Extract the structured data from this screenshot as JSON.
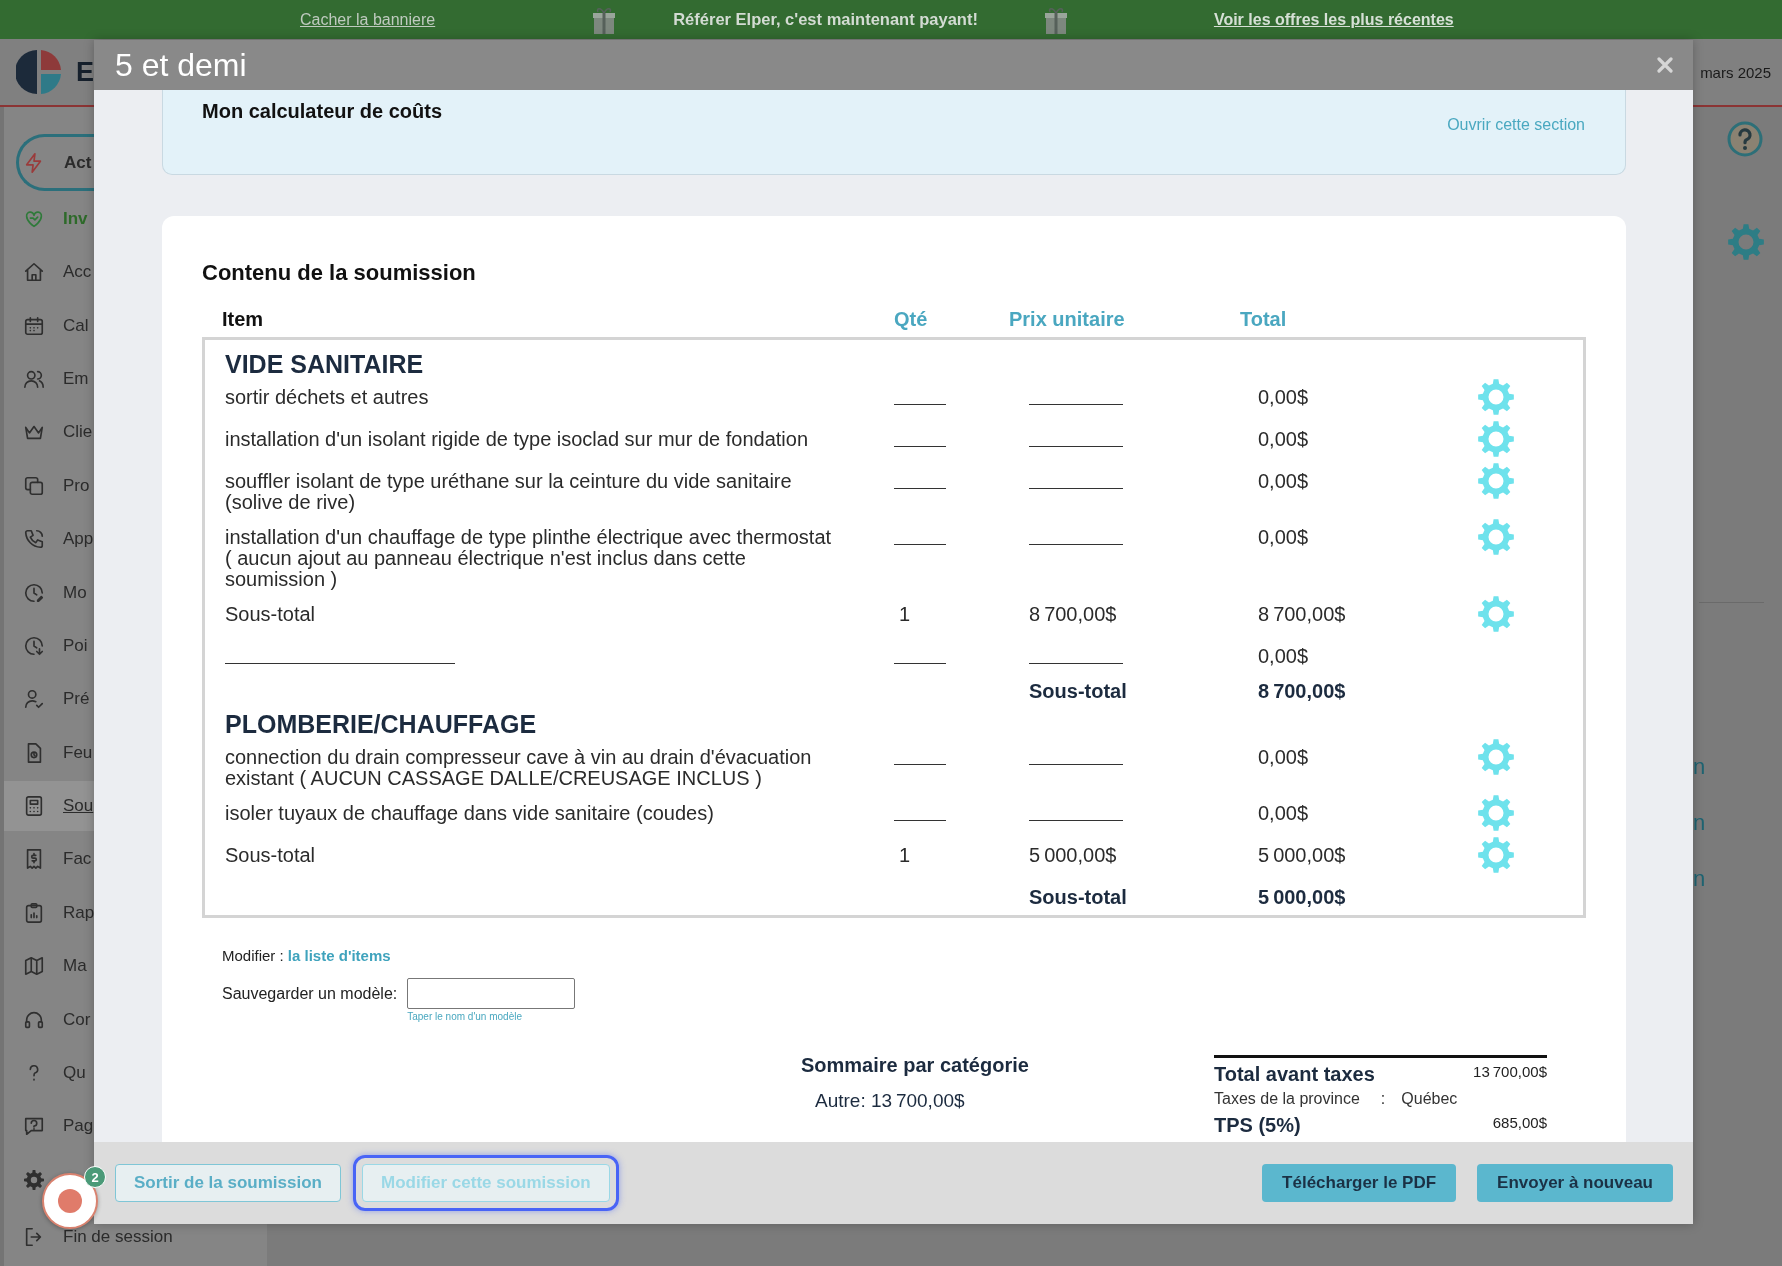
{
  "banner": {
    "hide_link": "Cacher la banniere",
    "message": "Référer Elper, c'est maintenant payant!",
    "offers_link": "Voir les offres les plus récentes"
  },
  "app_header": {
    "logo_text": "E",
    "date": "mars 2025"
  },
  "sidebar": {
    "items": [
      {
        "label": "Act",
        "kind": "action",
        "selected": false
      },
      {
        "label": "Inv",
        "kind": "invite",
        "selected": false
      },
      {
        "label": "Acc",
        "kind": "link",
        "selected": false
      },
      {
        "label": "Cal",
        "kind": "link",
        "selected": false
      },
      {
        "label": "Em",
        "kind": "link",
        "selected": false
      },
      {
        "label": "Clie",
        "kind": "link",
        "selected": false
      },
      {
        "label": "Pro",
        "kind": "link",
        "selected": false
      },
      {
        "label": "App",
        "kind": "link",
        "selected": false
      },
      {
        "label": "Mo",
        "kind": "link",
        "selected": false
      },
      {
        "label": "Poi",
        "kind": "link",
        "selected": false
      },
      {
        "label": "Pré",
        "kind": "link",
        "selected": false
      },
      {
        "label": "Feu",
        "kind": "link",
        "selected": false
      },
      {
        "label": "Sou",
        "kind": "link",
        "selected": true
      },
      {
        "label": "Fac",
        "kind": "link",
        "selected": false
      },
      {
        "label": "Rap",
        "kind": "link",
        "selected": false
      },
      {
        "label": "Ma",
        "kind": "link",
        "selected": false
      },
      {
        "label": "Cor",
        "kind": "link",
        "selected": false
      },
      {
        "label": "Qu",
        "kind": "link",
        "selected": false
      },
      {
        "label": "Pag",
        "kind": "link",
        "selected": false
      },
      {
        "kind": "link",
        "selected": false
      },
      {
        "label": "Fin de session",
        "kind": "link",
        "selected": false
      }
    ]
  },
  "right_panel": {
    "fragments": [
      "n",
      "n",
      "n"
    ]
  },
  "modal": {
    "title": "5 et demi",
    "calculator": {
      "title": "Mon calculateur de coûts",
      "open_link": "Ouvrir cette section"
    },
    "content": {
      "title": "Contenu de la soumission",
      "columns": [
        "Item",
        "Qté",
        "Prix unitaire",
        "Total"
      ],
      "categories": [
        {
          "name": "VIDE SANITAIRE",
          "rows": [
            {
              "kind": "item",
              "description": "sortir déchets et autres",
              "total": "0,00$"
            },
            {
              "kind": "item",
              "description": "installation d'un isolant rigide de type isoclad sur mur de fondation",
              "total": "0,00$"
            },
            {
              "kind": "item",
              "description": "souffler isolant de type uréthane sur la ceinture du vide sanitaire\n(solive de rive)",
              "total": "0,00$"
            },
            {
              "kind": "item",
              "description": "installation d'un chauffage de type plinthe électrique avec thermostat\n( aucun ajout au panneau électrique n'est inclus dans cette\nsoumission )",
              "total": "0,00$"
            },
            {
              "kind": "subtotal",
              "description": "Sous-total",
              "qty": "1",
              "unit_price": "8 700,00$",
              "total": "8 700,00$"
            },
            {
              "kind": "blank",
              "total": "0,00$"
            },
            {
              "kind": "total",
              "label": "Sous-total",
              "total": "8 700,00$"
            }
          ]
        },
        {
          "name": "PLOMBERIE/CHAUFFAGE",
          "rows": [
            {
              "kind": "item",
              "description": "connection du drain compresseur cave à vin au drain d'évacuation\nexistant ( AUCUN CASSAGE DALLE/CREUSAGE INCLUS )",
              "total": "0,00$"
            },
            {
              "kind": "item",
              "description": "isoler tuyaux de chauffage dans vide sanitaire (coudes)",
              "total": "0,00$"
            },
            {
              "kind": "subtotal",
              "description": "Sous-total",
              "qty": "1",
              "unit_price": "5 000,00$",
              "total": "5 000,00$"
            },
            {
              "kind": "total",
              "label": "Sous-total",
              "total": "5 000,00$"
            }
          ]
        }
      ]
    },
    "edit_list": {
      "label": "Modifier :",
      "link": "la liste d'items"
    },
    "template": {
      "label": "Sauvegarder un modèle:",
      "hint": "Taper le nom d'un modèle"
    },
    "summary": {
      "title": "Sommaire par catégorie",
      "lines": [
        "Autre: 13 700,00$"
      ]
    },
    "totals": {
      "rows": [
        {
          "kind": "major",
          "label": "Total avant taxes",
          "value": "13 700,00$"
        },
        {
          "kind": "detail",
          "label": "Taxes de la province",
          "separator": ":",
          "value": "Québec"
        },
        {
          "kind": "major",
          "label": "TPS (5%)",
          "value": "685,00$"
        }
      ]
    },
    "footer": {
      "left_buttons": [
        {
          "label": "Sortir de la soumission",
          "kind": "outline",
          "focused": false
        },
        {
          "label": "Modifier cette soumission",
          "kind": "outline",
          "focused": true
        }
      ],
      "right_buttons": [
        {
          "label": "Télécharger le PDF",
          "kind": "filled"
        },
        {
          "label": "Envoyer à nouveau",
          "kind": "filled"
        }
      ]
    }
  },
  "floating_button": {
    "badge": "2"
  }
}
